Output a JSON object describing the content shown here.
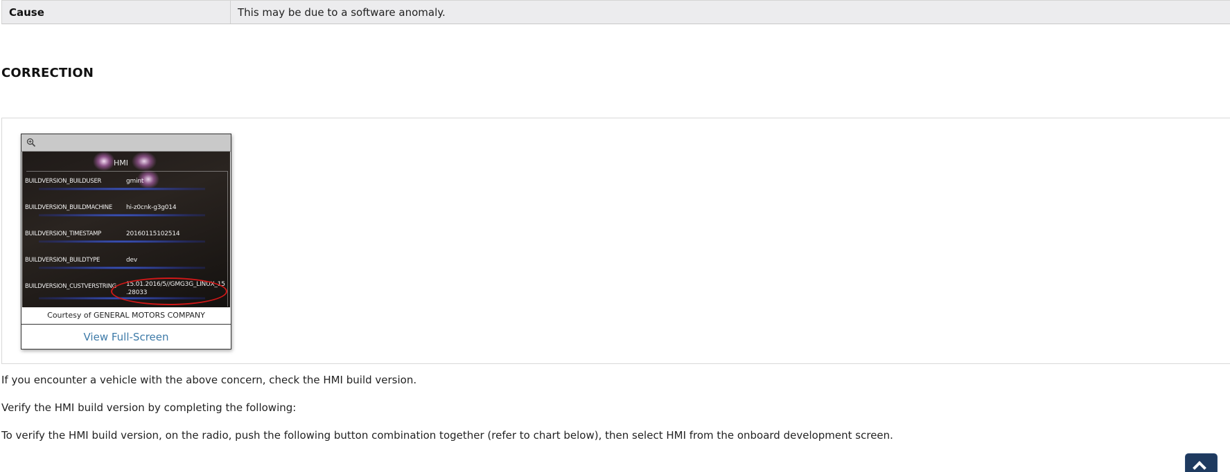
{
  "cause_row": {
    "label": "Cause",
    "value": "This may be due to a software anomaly."
  },
  "correction": {
    "heading": "CORRECTION"
  },
  "figure": {
    "zoom_icon": "zoom-in-icon",
    "image": {
      "title": "HMI",
      "rows": [
        {
          "key": "BUILDVERSION_BUILDUSER",
          "value": "gmint"
        },
        {
          "key": "BUILDVERSION_BUILDMACHINE",
          "value": "hi-z0cnk-g3g014"
        },
        {
          "key": "BUILDVERSION_TIMESTAMP",
          "value": "20160115102514"
        },
        {
          "key": "BUILDVERSION_BUILDTYPE",
          "value": "dev"
        },
        {
          "key": "BUILDVERSION_CUSTVERSTRING",
          "value_line1": "15.01.2016/5//GMG3G_LINUX_15",
          "value_line2": ".28033"
        }
      ]
    },
    "caption": "Courtesy of GENERAL MOTORS COMPANY",
    "link_label": "View Full-Screen"
  },
  "paragraphs": {
    "p1": "If you encounter a vehicle with the above concern, check the HMI build version.",
    "p2": "Verify the HMI build version by completing the following:",
    "p3": "To verify the HMI build version, on the radio, push the following button combination together (refer to chart below), then select HMI from the onboard development screen."
  },
  "back_to_top": {
    "icon": "chevron-up-icon",
    "color": "#1e3a5f"
  },
  "colors": {
    "link": "#3d7aa8",
    "table_bg": "#ececee",
    "highlight_oval": "#d01818"
  }
}
